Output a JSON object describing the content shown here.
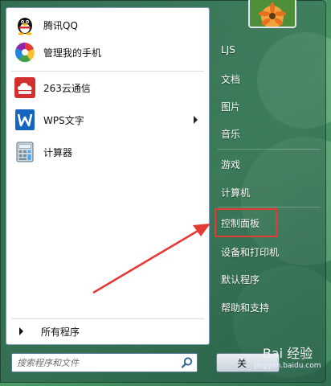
{
  "programs": [
    {
      "label": "腾讯QQ",
      "icon": "qq-penguin-icon"
    },
    {
      "label": "管理我的手机",
      "icon": "phone-manager-icon"
    },
    {
      "label": "263云通信",
      "icon": "263-cloud-icon"
    },
    {
      "label": "WPS文字",
      "icon": "wps-writer-icon",
      "has_submenu": true
    },
    {
      "label": "计算器",
      "icon": "calculator-icon"
    }
  ],
  "all_programs_label": "所有程序",
  "search": {
    "placeholder": "搜索程序和文件"
  },
  "right_items": [
    {
      "label": "LJS"
    },
    {
      "label": "文档"
    },
    {
      "label": "图片"
    },
    {
      "label": "音乐"
    },
    {
      "label": "游戏"
    },
    {
      "label": "计算机"
    },
    {
      "label": "控制面板",
      "highlighted": true
    },
    {
      "label": "设备和打印机"
    },
    {
      "label": "默认程序"
    },
    {
      "label": "帮助和支持"
    }
  ],
  "shutdown_label": "关",
  "watermark": {
    "brand": "Bai 经验",
    "url": "jingyan.baidu.com"
  },
  "colors": {
    "highlight": "#e53935",
    "arrow": "#e53935"
  }
}
